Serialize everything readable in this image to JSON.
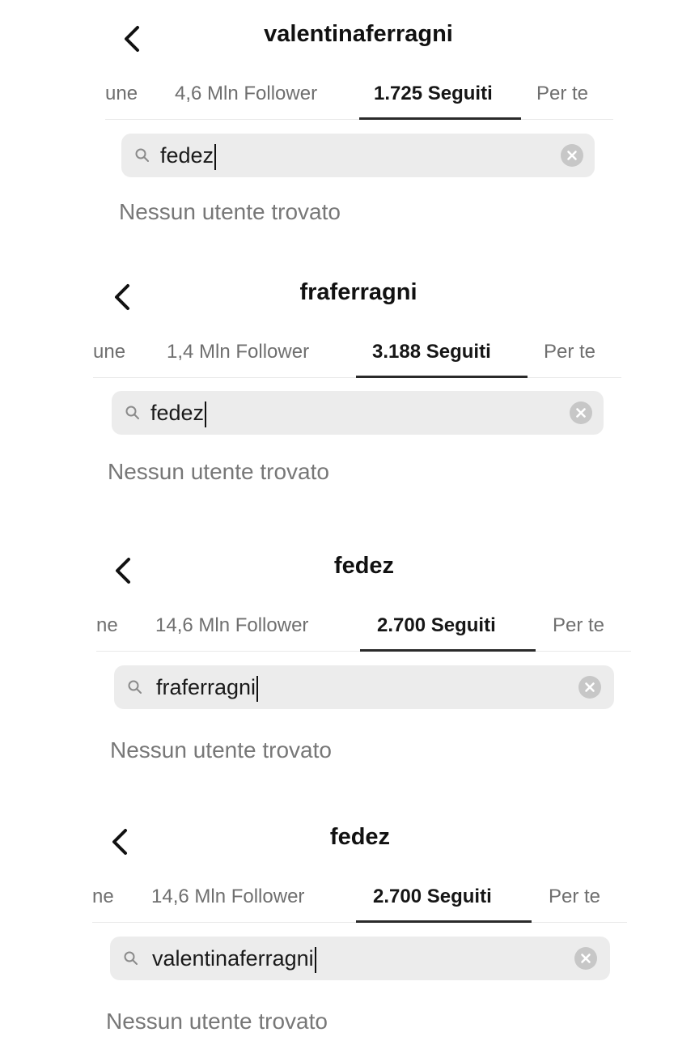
{
  "panels": [
    {
      "title": "valentinaferragni",
      "tabs": [
        "une",
        "4,6 Mln Follower",
        "1.725 Seguiti",
        "Per te"
      ],
      "search_value": "fedez",
      "result_text": "Nessun utente trovato"
    },
    {
      "title": "fraferragni",
      "tabs": [
        "une",
        "1,4 Mln Follower",
        "3.188 Seguiti",
        "Per te"
      ],
      "search_value": "fedez",
      "result_text": "Nessun utente trovato"
    },
    {
      "title": "fedez",
      "tabs": [
        "ne",
        "14,6 Mln Follower",
        "2.700 Seguiti",
        "Per te"
      ],
      "search_value": "fraferragni",
      "result_text": "Nessun utente trovato"
    },
    {
      "title": "fedez",
      "tabs": [
        "ne",
        "14,6 Mln Follower",
        "2.700 Seguiti",
        "Per te"
      ],
      "search_value": "valentinaferragni",
      "result_text": "Nessun utente trovato"
    }
  ],
  "icons": {
    "back": "chevron-left-icon",
    "search": "search-icon",
    "clear": "clear-circle-icon"
  },
  "colors": {
    "active_tab": "#161616",
    "inactive_tab": "#6f6f6f",
    "search_bg": "#ececec",
    "status_text": "#777777"
  },
  "active_tab_index": 2
}
